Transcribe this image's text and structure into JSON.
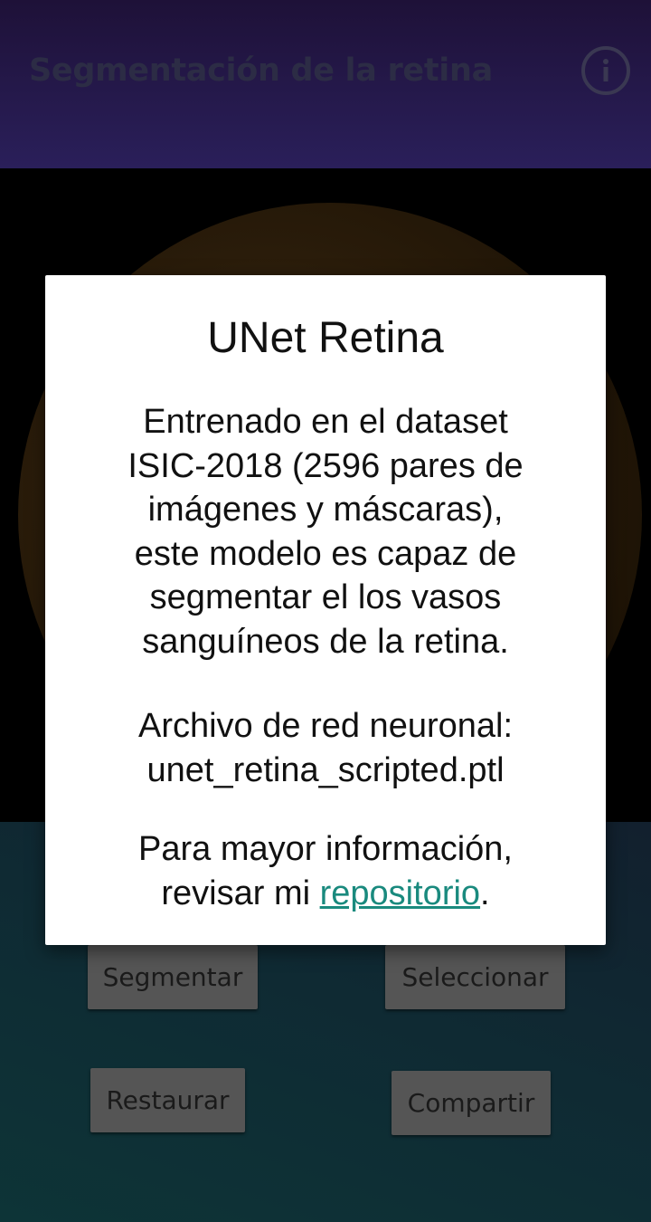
{
  "header": {
    "title": "Segmentación de la retina",
    "info_icon": "info-icon"
  },
  "image": {
    "alt": "retina fundus image"
  },
  "buttons": {
    "segment": "Segmentar",
    "select": "Seleccionar",
    "restore": "Restaurar",
    "share": "Compartir"
  },
  "dialog": {
    "title": "UNet Retina",
    "description_lines": [
      "Entrenado en el dataset",
      "ISIC-2018 (2596 pares de",
      "imágenes y máscaras),",
      "este modelo es capaz de",
      "segmentar el los vasos",
      "sanguíneos de la retina."
    ],
    "file_label": "Archivo de red neuronal:",
    "file_name": "unet_retina_scripted.ptl",
    "more_info_line1": "Para mayor información,",
    "more_info_prefix": "revisar mi ",
    "link_text": "repositorio",
    "more_info_suffix": "."
  },
  "colors": {
    "link": "#1a8a7e",
    "button_bg": "#555555",
    "header_bg": "#24184a"
  }
}
